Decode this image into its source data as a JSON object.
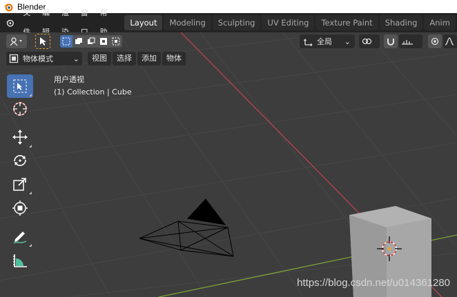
{
  "window": {
    "title": "Blender"
  },
  "menubar": {
    "items": [
      "文件",
      "编辑",
      "渲染",
      "窗口",
      "帮助"
    ],
    "workspace_tabs": [
      {
        "label": "Layout",
        "active": true
      },
      {
        "label": "Modeling",
        "active": false
      },
      {
        "label": "Sculpting",
        "active": false
      },
      {
        "label": "UV Editing",
        "active": false
      },
      {
        "label": "Texture Paint",
        "active": false
      },
      {
        "label": "Shading",
        "active": false
      },
      {
        "label": "Anim",
        "active": false
      }
    ]
  },
  "header": {
    "transform_orientation": "全局",
    "mode": "物体模式",
    "menus": [
      "视图",
      "选择",
      "添加",
      "物体"
    ]
  },
  "viewport": {
    "view_name": "用户透视",
    "collection_info": "(1) Collection | Cube"
  },
  "toolbar": {
    "tools": [
      {
        "name": "select-box",
        "active": true
      },
      {
        "name": "cursor",
        "active": false
      },
      {
        "name": "move",
        "active": false
      },
      {
        "name": "rotate",
        "active": false
      },
      {
        "name": "scale",
        "active": false
      },
      {
        "name": "transform",
        "active": false
      },
      {
        "name": "annotate",
        "active": false
      },
      {
        "name": "measure",
        "active": false
      }
    ]
  },
  "watermark": "https://blog.csdn.net/u014361280",
  "colors": {
    "active_blue": "#4772b3",
    "x_axis": "#b5454f",
    "y_axis": "#7ba53a",
    "cube": "#a5a5a5"
  }
}
